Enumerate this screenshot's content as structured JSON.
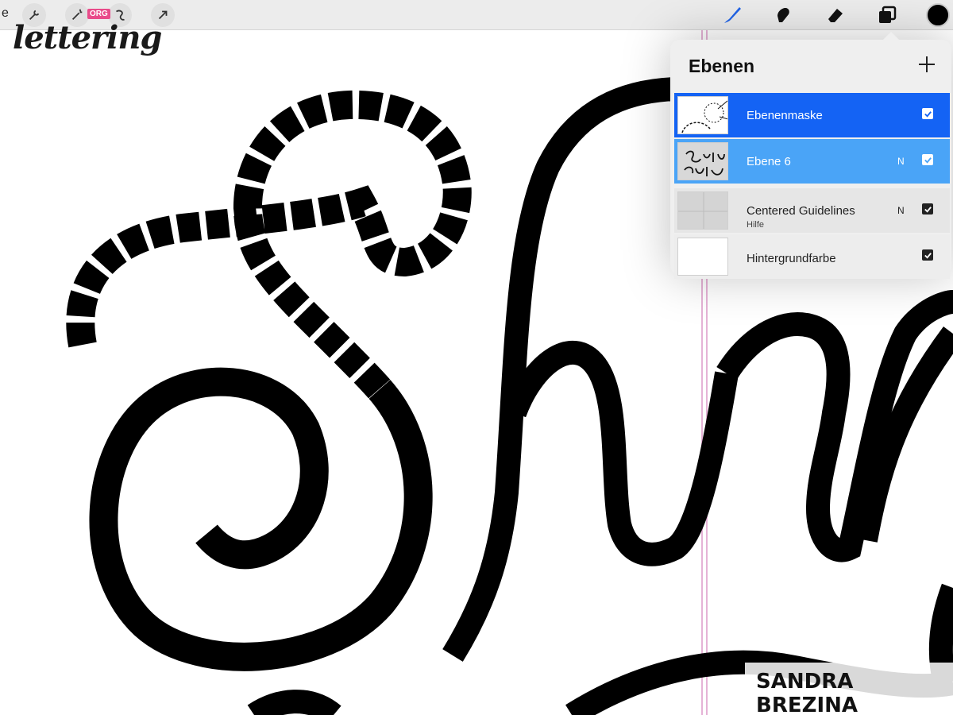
{
  "toolbar": {
    "edge_letter": "e",
    "tools": [
      {
        "name": "brush",
        "icon": "brush-icon",
        "active": true,
        "color": "#1f63e8"
      },
      {
        "name": "smudge",
        "icon": "smudge-icon",
        "active": false
      },
      {
        "name": "eraser",
        "icon": "eraser-icon",
        "active": false
      },
      {
        "name": "layers",
        "icon": "layers-icon",
        "active": false
      }
    ],
    "left_buttons": [
      "wrench-icon",
      "magic-wand-icon",
      "selection-icon",
      "transform-arrow-icon"
    ],
    "current_color": "#000000"
  },
  "logo": {
    "text": "lettering",
    "badge": "ORG"
  },
  "layers_panel": {
    "title": "Ebenen",
    "add_icon": "plus-icon",
    "layers": [
      {
        "name": "Ebenenmaske",
        "blend": "",
        "sub": "",
        "visible": true,
        "state": "selected"
      },
      {
        "name": "Ebene 6",
        "blend": "N",
        "sub": "",
        "visible": true,
        "state": "secondary"
      },
      {
        "name": "Centered Guidelines",
        "blend": "N",
        "sub": "Hilfe",
        "visible": true,
        "state": "normal"
      },
      {
        "name": "Hintergrundfarbe",
        "blend": "",
        "sub": "",
        "visible": true,
        "state": "normal"
      }
    ]
  },
  "watermark": "SANDRA BREZINA",
  "colors": {
    "accent": "#1463f4",
    "secondary_selection": "#4aa4f7",
    "guide_line": "#e5b3d6"
  }
}
